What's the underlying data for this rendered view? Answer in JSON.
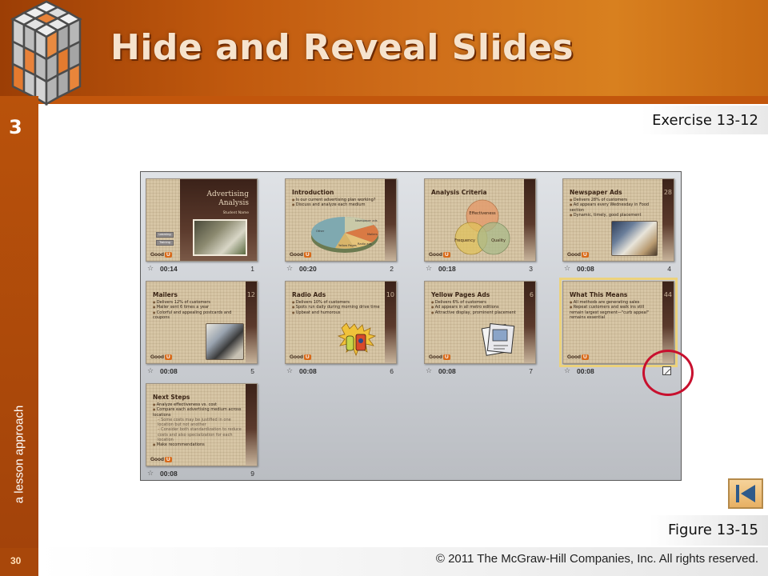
{
  "header": {
    "title": "Hide and Reveal Slides"
  },
  "sidebar": {
    "lesson_number": "3",
    "vertical_text": "a lesson approach",
    "page_number": "30"
  },
  "labels": {
    "exercise": "Exercise 13-12",
    "figure": "Figure 13-15"
  },
  "footer": {
    "copyright": "© 2011 The McGraw-Hill Companies, Inc. All rights reserved."
  },
  "slides": [
    {
      "index": "1",
      "time": "00:14",
      "title_line1": "Advertising",
      "title_line2": "Analysis",
      "subtitle": "Student Name",
      "buttons": [
        "Learning",
        "Training"
      ],
      "logo": "Good",
      "logo_mark": "U"
    },
    {
      "index": "2",
      "time": "00:20",
      "title": "Introduction",
      "bullets": [
        "Is our current advertising plan working?",
        "Discuss and analyze each medium"
      ],
      "pie_labels": [
        "Newspaper ads",
        "Mailers",
        "Radio ads",
        "Yellow Pages",
        "Other"
      ],
      "logo": "Good",
      "logo_mark": "U"
    },
    {
      "index": "3",
      "time": "00:18",
      "title": "Analysis Criteria",
      "venn_labels": [
        "Effectiveness",
        "Frequency",
        "Quality"
      ],
      "logo": "Good",
      "logo_mark": "U"
    },
    {
      "index": "4",
      "time": "00:08",
      "title": "Newspaper Ads",
      "slide_number": "28",
      "bullets": [
        "Delivers 28% of customers",
        "Ad appears every Wednesday in Food section",
        "Dynamic, timely, good placement"
      ],
      "logo": "Good",
      "logo_mark": "U"
    },
    {
      "index": "5",
      "time": "00:08",
      "title": "Mailers",
      "slide_number": "12",
      "bullets": [
        "Delivers 12% of customers",
        "Mailer sent 6 times a year",
        "Colorful and appealing postcards and coupons"
      ],
      "logo": "Good",
      "logo_mark": "U"
    },
    {
      "index": "6",
      "time": "00:08",
      "title": "Radio Ads",
      "slide_number": "10",
      "bullets": [
        "Delivers 10% of customers",
        "Spots run daily during morning drive time",
        "Upbeat and humorous"
      ],
      "logo": "Good",
      "logo_mark": "U"
    },
    {
      "index": "7",
      "time": "00:08",
      "title": "Yellow Pages Ads",
      "slide_number": "6",
      "bullets": [
        "Delivers 6% of customers",
        "Ad appears in all metro editions",
        "Attractive display, prominent placement"
      ],
      "logo": "Good",
      "logo_mark": "U"
    },
    {
      "index": "8",
      "time": "00:08",
      "title": "What This Means",
      "slide_number": "44",
      "bullets": [
        "All methods are generating sales",
        "Repeat customers and walk ins still remain largest segment—\"curb appeal\" remains essential"
      ],
      "logo": "Good",
      "logo_mark": "U",
      "hidden": true
    },
    {
      "index": "9",
      "time": "00:08",
      "title": "Next Steps",
      "bullets": [
        "Analyze effectiveness vs. cost",
        "Compare each advertising medium across locations"
      ],
      "sub_bullets": [
        "Some costs may be justified in one location but not another",
        "Consider both standardization to reduce costs and also specialization for each location"
      ],
      "bullets2": [
        "Make recommendations"
      ],
      "logo": "Good",
      "logo_mark": "U"
    }
  ],
  "colors": {
    "accent": "#c0590e",
    "sidebar": "#a8470a",
    "highlight_circle": "#c8102e",
    "selection": "#ecd27c"
  },
  "icons": {
    "back": "back-to-start-icon",
    "hidden_slide": "hidden-slide-icon",
    "transition": "transition-star-icon"
  }
}
